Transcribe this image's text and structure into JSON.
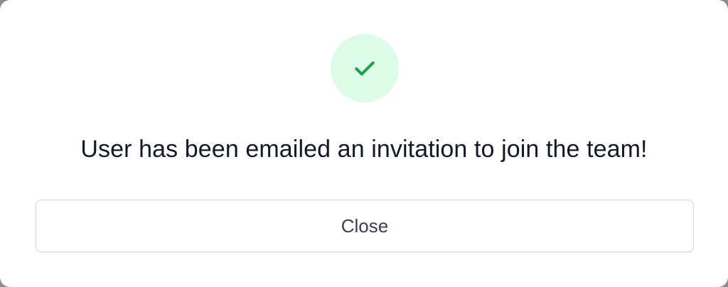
{
  "dialog": {
    "icon": "check-icon",
    "message": "User has been emailed an invitation to join the team!",
    "close_label": "Close"
  },
  "colors": {
    "success_bg": "#dcfce7",
    "success_icon": "#16a34a",
    "text": "#111827",
    "button_border": "#d1d5db",
    "button_text": "#374151"
  }
}
